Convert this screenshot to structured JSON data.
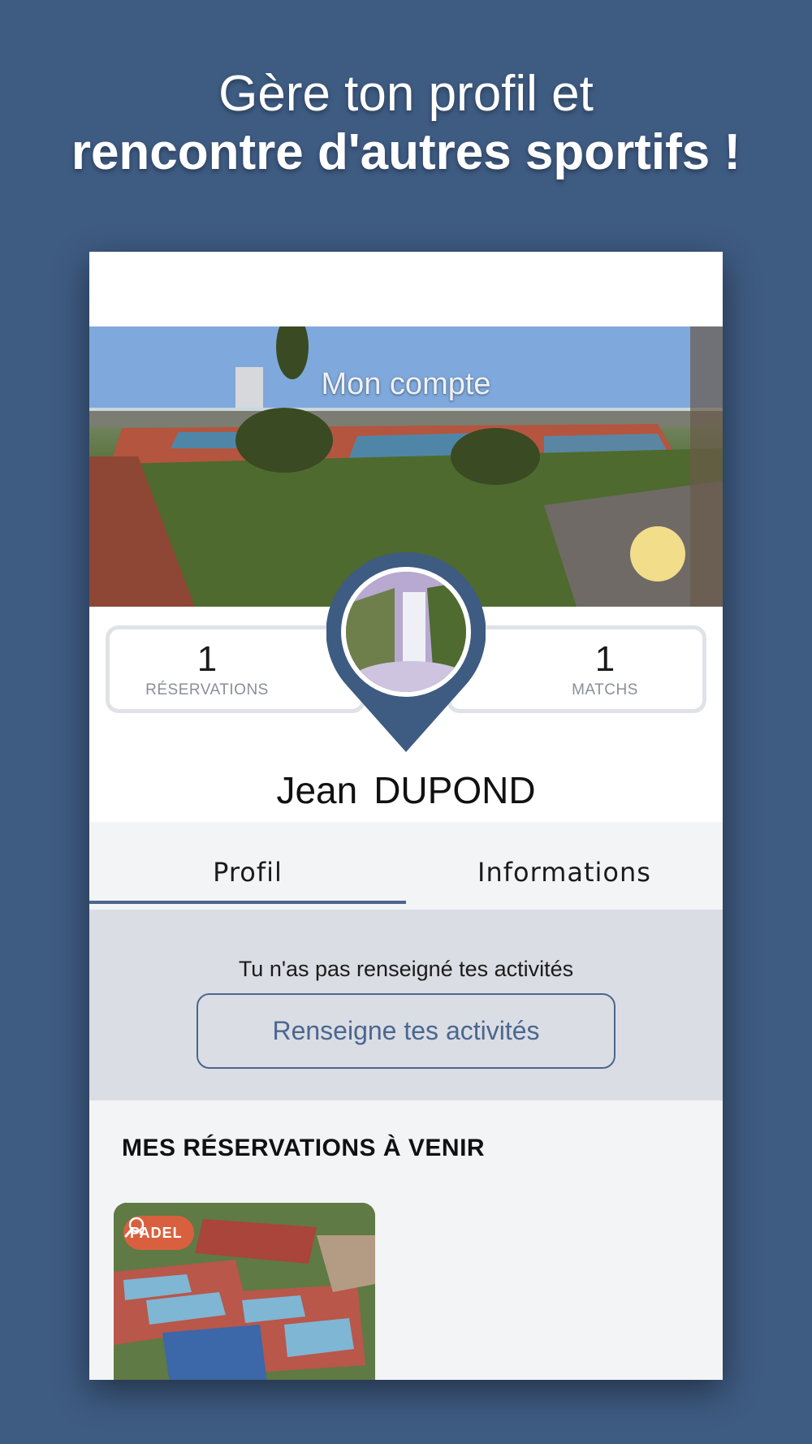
{
  "promo": {
    "line1": "Gère ton profil et",
    "line2": "rencontre d'autres sportifs !"
  },
  "header": {
    "title": "Mon compte"
  },
  "stats": {
    "reservations": {
      "value": "1",
      "label": "RÉSERVATIONS"
    },
    "matchs": {
      "value": "1",
      "label": "MATCHS"
    }
  },
  "user": {
    "first_name": "Jean",
    "last_name": "DUPOND"
  },
  "tabs": [
    {
      "label": "Profil",
      "active": true
    },
    {
      "label": "Informations",
      "active": false
    }
  ],
  "activities": {
    "message": "Tu n'as pas renseigné tes activités",
    "button_label": "Renseigne tes activités"
  },
  "upcoming": {
    "section_title": "MES RÉSERVATIONS À VENIR",
    "cards": [
      {
        "sport": "PADEL",
        "icon": "racket-icon"
      }
    ]
  },
  "colors": {
    "background": "#3e5b82",
    "accent": "#4b6690",
    "badge": "#d9603f"
  }
}
